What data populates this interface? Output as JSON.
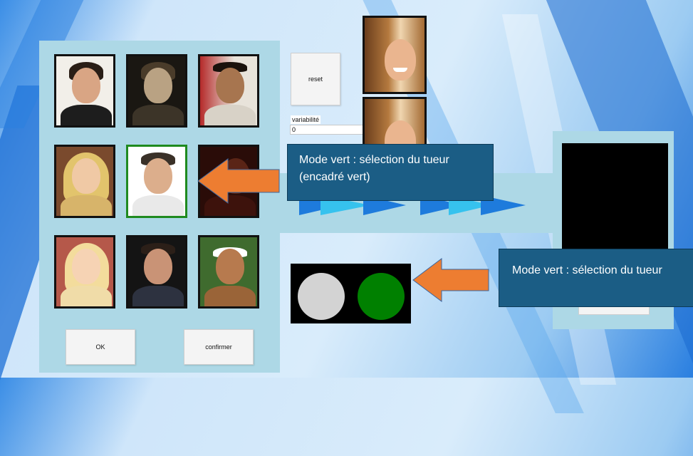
{
  "buttons": {
    "ok": "OK",
    "confirm": "confirmer",
    "reset": "reset"
  },
  "variability": {
    "label": "variabilité",
    "value": "0"
  },
  "callouts": {
    "first": {
      "line1": "Mode vert : sélection du tueur",
      "line2": "(encadré vert)"
    },
    "second": "Mode vert : sélection du tueur"
  },
  "grid": {
    "selected_index": 4,
    "photos": [
      {
        "name": "suspect-1"
      },
      {
        "name": "suspect-2"
      },
      {
        "name": "suspect-3"
      },
      {
        "name": "suspect-4"
      },
      {
        "name": "suspect-5"
      },
      {
        "name": "suspect-6"
      },
      {
        "name": "suspect-7"
      },
      {
        "name": "suspect-8"
      },
      {
        "name": "suspect-9"
      }
    ]
  },
  "indicator": {
    "left_light": "off",
    "right_light": "on"
  },
  "colors": {
    "panel": "#add8e6",
    "callout": "#1b5d85",
    "arrow": "#ed7d31",
    "selected_border": "#1f8a1f",
    "light_on": "#008000",
    "light_off": "#d3d3d3"
  }
}
